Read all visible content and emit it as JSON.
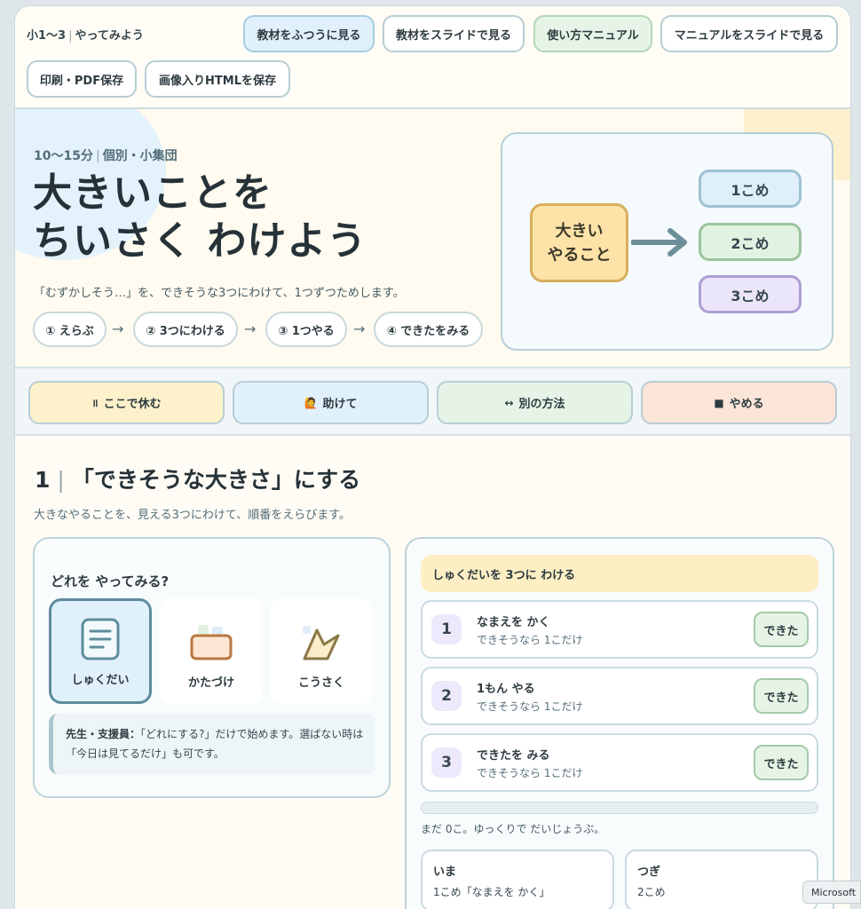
{
  "topbar": {
    "grade": "小1〜3",
    "mode": "やってみよう",
    "buttons": {
      "view_normal": "教材をふつうに見る",
      "view_slides": "教材をスライドで見る",
      "manual": "使い方マニュアル",
      "manual_slides": "マニュアルをスライドで見る",
      "print_pdf": "印刷・PDF保存",
      "save_html": "画像入りHTMLを保存"
    }
  },
  "hero": {
    "duration": "10〜15分",
    "group": "個別・小集団",
    "title_line1": "大きいことを",
    "title_line2": "ちいさく わけよう",
    "description": "「むずかしそう…」を、できそうな3つにわけて、1つずつためします。",
    "steps": [
      "① えらぶ",
      "② 3つにわける",
      "③ 1つやる",
      "④ できたをみる"
    ],
    "step_arrow": "→",
    "diagram": {
      "big_task_line1": "大きい",
      "big_task_line2": "やること",
      "parts": [
        "1こめ",
        "2こめ",
        "3こめ"
      ]
    }
  },
  "actions": {
    "pause": {
      "icon": "॥",
      "label": "ここで休む"
    },
    "help": {
      "icon": "🙋",
      "label": "助けて"
    },
    "other": {
      "icon": "↔",
      "label": "別の方法"
    },
    "stop": {
      "icon": "■",
      "label": "やめる"
    }
  },
  "section": {
    "number": "1",
    "title": "「できそうな大きさ」にする",
    "description": "大きなやることを、見える3つにわけて、順番をえらびます。",
    "choose_question": "どれを やってみる?",
    "choices": [
      "しゅくだい",
      "かたづけ",
      "こうさく"
    ],
    "selected_choice": "しゅくだい",
    "note_label": "先生・支援員：",
    "note_text": "「どれにする?」だけで始めます。選ばない時は「今日は見てるだけ」も可です。"
  },
  "split": {
    "header": "しゅくだいを 3つに わける",
    "tasks": [
      {
        "num": "1",
        "title": "なまえを かく",
        "sub": "できそうなら 1こだけ",
        "button": "できた"
      },
      {
        "num": "2",
        "title": "1もん やる",
        "sub": "できそうなら 1こだけ",
        "button": "できた"
      },
      {
        "num": "3",
        "title": "できたを みる",
        "sub": "できそうなら 1こだけ",
        "button": "できた"
      }
    ],
    "progress": 0,
    "progress_text": "まだ 0こ。ゆっくりで だいじょうぶ。",
    "now_label": "いま",
    "now_value": "1こめ「なまえを かく」",
    "next_label": "つぎ",
    "next_value": "2こめ"
  },
  "overlay": {
    "ms_label": "Microsoft"
  },
  "colors": {
    "accent_blue": "#e1f1fb",
    "accent_green": "#e5f4e6",
    "accent_yellow": "#fdf1cc",
    "accent_red": "#fbe4d8"
  }
}
